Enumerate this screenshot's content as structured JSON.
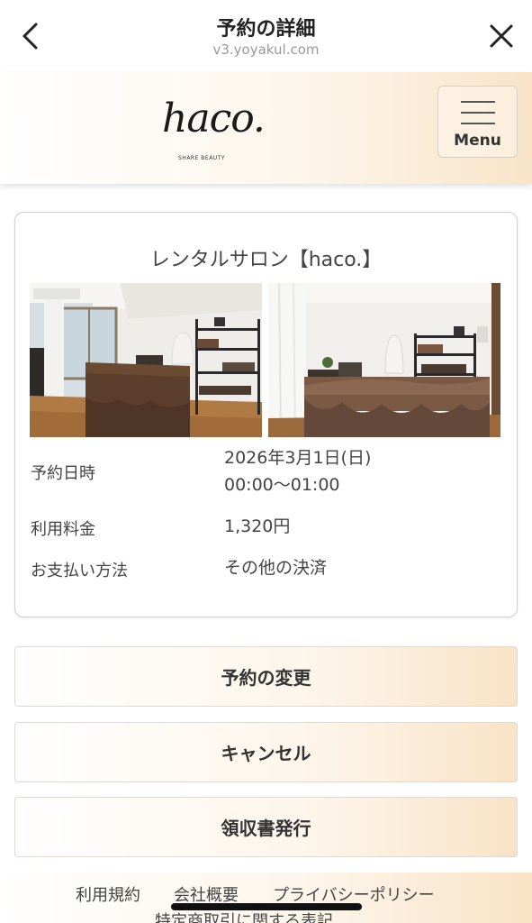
{
  "browser": {
    "title": "予約の詳細",
    "url": "v3.yoyakul.com",
    "back_icon": "chevron-left-icon",
    "close_icon": "close-icon"
  },
  "header": {
    "logo_text": "haco.",
    "logo_sub": "SHARE BEAUTY",
    "menu_label": "Menu",
    "menu_icon": "hamburger-icon"
  },
  "reservation": {
    "salon_name": "レンタルサロン【haco.】",
    "details": [
      {
        "label": "予約日時",
        "value_lines": [
          "2026年3月1日(日)",
          "00:00〜01:00"
        ]
      },
      {
        "label": "利用料金",
        "value_lines": [
          "1,320円"
        ]
      },
      {
        "label": "お支払い方法",
        "value_lines": [
          "その他の決済"
        ]
      }
    ]
  },
  "actions": {
    "change": "予約の変更",
    "cancel": "キャンセル",
    "receipt": "領収書発行"
  },
  "footer": {
    "links": [
      "利用規約",
      "会社概要",
      "プライバシーポリシー"
    ],
    "link_2": "特定商取引に関する表記"
  },
  "colors": {
    "accent_gradient_end": "#f9e3c6",
    "text": "#333333",
    "url_gray": "#9a9a9a"
  }
}
